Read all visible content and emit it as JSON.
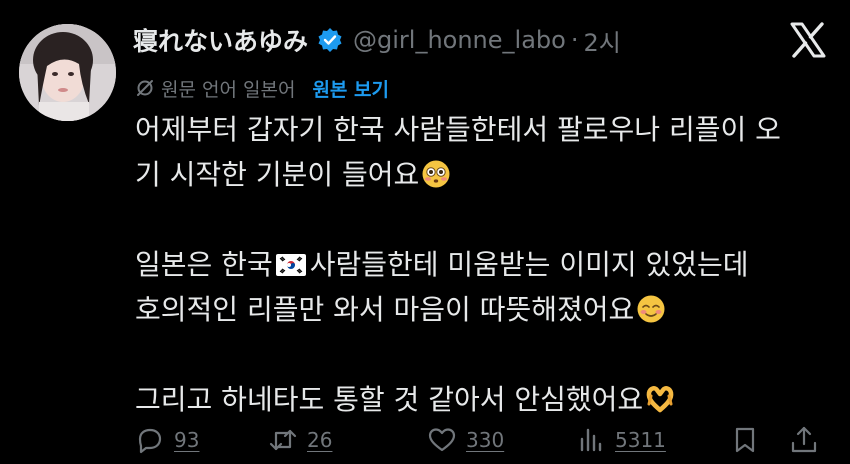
{
  "tweet": {
    "display_name": "寝れないあゆみ",
    "handle": "@girl_honne_labo",
    "separator": "·",
    "time": "2시",
    "translation": {
      "note": "원문 언어 일본어",
      "link": "원본 보기"
    },
    "paragraphs": [
      [
        "어제부터 갑자기 한국 사람들한테서 팔로우나 리플이 오",
        "기 시작한 기분이 들어요"
      ],
      [
        "일본은 한국",
        "사람들한테 미움받는 이미지 있었는데",
        "호의적인 리플만 와서 마음이 따뜻해졌어요"
      ],
      [
        "그리고 하네타도 통할 것 같아서 안심했어요"
      ]
    ]
  },
  "actions": {
    "replies": "93",
    "reposts": "26",
    "likes": "330",
    "views": "5311"
  },
  "icons": {
    "verified": "verified-badge-icon",
    "x_logo": "x-logo-icon",
    "translate": "translate-icon",
    "reply": "reply-icon",
    "repost": "repost-icon",
    "like": "heart-icon",
    "views": "views-chart-icon",
    "bookmark": "bookmark-icon",
    "share": "share-icon",
    "flushed": "flushed-face-emoji-icon",
    "smiling": "smiling-face-emoji-icon",
    "heart_hands": "heart-hands-emoji-icon",
    "flag": "south-korea-flag-icon"
  },
  "colors": {
    "background": "#000000",
    "text": "#e7e9ea",
    "secondary": "#71767b",
    "link": "#1d9bf0",
    "verified": "#1d9bf0"
  }
}
